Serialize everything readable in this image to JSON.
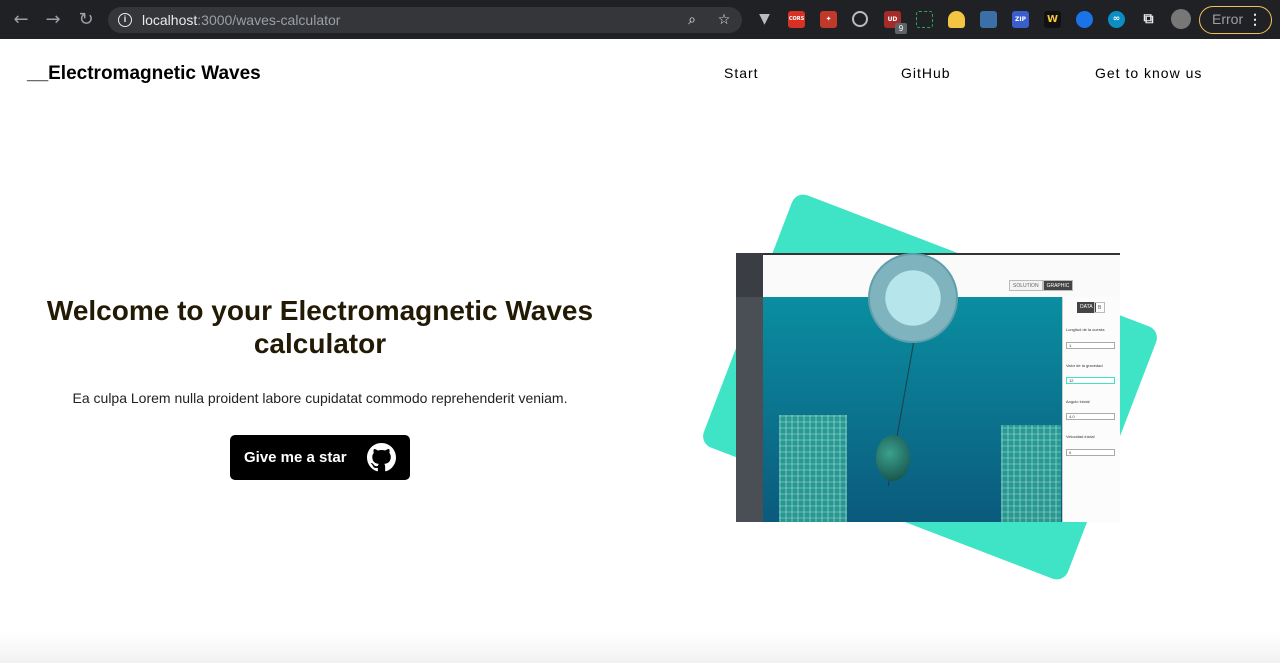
{
  "browser": {
    "url_host": "localhost",
    "url_path": ":3000/waves-calculator",
    "error_label": "Error",
    "extension_badge": "9",
    "ext_labels": {
      "cors": "CORS",
      "ud": "UD",
      "zip": "ZIP",
      "w": "W"
    }
  },
  "header": {
    "logo": "__Electromagnetic Waves",
    "nav": [
      "Start",
      "GitHub",
      "Get to know us"
    ]
  },
  "hero": {
    "title": "Welcome to your Electromagnetic Waves calculator",
    "subtitle": "Ea culpa Lorem nulla proident labore cupidatat commodo reprehenderit veniam.",
    "star_button": "Give me a star"
  },
  "preview": {
    "tabs": [
      "SOLUTION",
      "GRAPHIC"
    ],
    "panel_tabs": [
      "DATA",
      "B"
    ],
    "fields": [
      {
        "label": "Longitud de la cuerda",
        "value": "1"
      },
      {
        "label": "Valor de la gravedad",
        "value": "12"
      },
      {
        "label": "Angulo inicial",
        "value": "4.0"
      },
      {
        "label": "Velocidad inicial",
        "value": "0"
      }
    ]
  },
  "colors": {
    "accent": "#3fe3c6",
    "title": "#231a05",
    "button": "#000000"
  }
}
